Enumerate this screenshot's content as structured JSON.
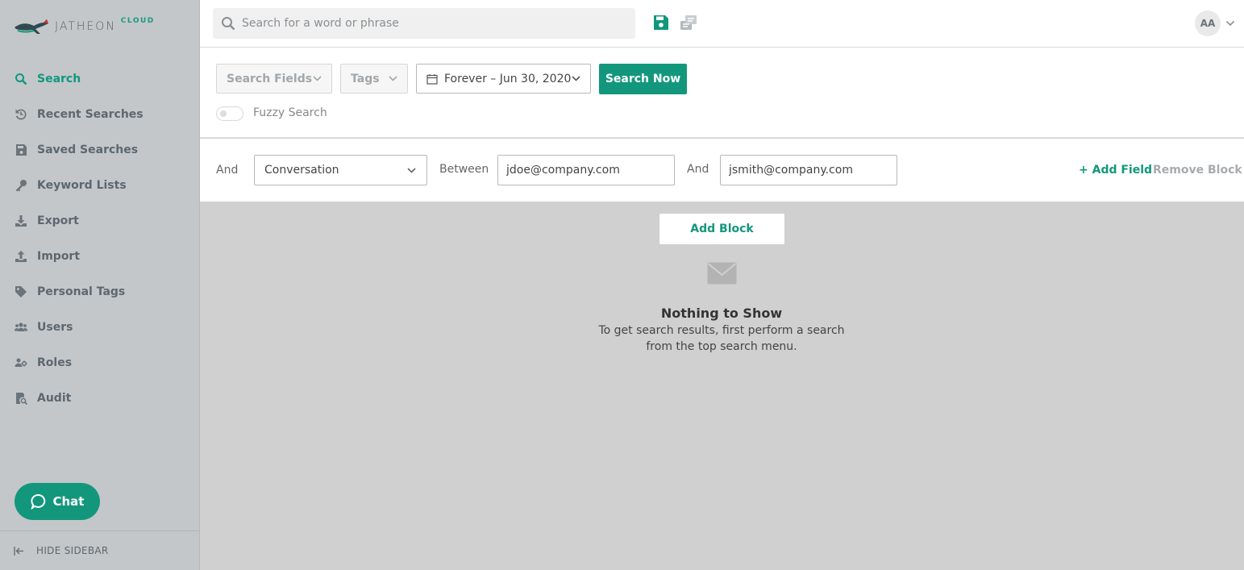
{
  "brand": {
    "name": "JATHEON",
    "suffix": "CLOUD",
    "accent_color": "#12977c"
  },
  "topbar": {
    "search_placeholder": "Search for a word or phrase",
    "avatar_initials": "AA",
    "icons": [
      "search-icon",
      "save-icon",
      "sync-icon",
      "chevron-down-icon"
    ]
  },
  "sidebar": {
    "items": [
      {
        "label": "Search",
        "icon": "search-icon",
        "active": true
      },
      {
        "label": "Recent Searches",
        "icon": "history-icon"
      },
      {
        "label": "Saved Searches",
        "icon": "save-icon"
      },
      {
        "label": "Keyword Lists",
        "icon": "key-icon"
      },
      {
        "label": "Export",
        "icon": "download-icon"
      },
      {
        "label": "Import",
        "icon": "upload-icon"
      },
      {
        "label": "Personal Tags",
        "icon": "tag-icon"
      },
      {
        "label": "Users",
        "icon": "users-icon"
      },
      {
        "label": "Roles",
        "icon": "roles-icon"
      },
      {
        "label": "Audit",
        "icon": "audit-icon"
      }
    ],
    "chat_label": "Chat",
    "hide_label": "HIDE SIDEBAR"
  },
  "filters": {
    "search_fields_label": "Search Fields",
    "tags_label": "Tags",
    "date_range": "Forever – Jun 30, 2020",
    "search_now_label": "Search Now",
    "fuzzy_label": "Fuzzy Search",
    "fuzzy_enabled": false
  },
  "block": {
    "and_label": "And",
    "field_value": "Conversation",
    "between_label": "Between",
    "first_value": "jdoe@company.com",
    "and2_label": "And",
    "second_value": "jsmith@company.com",
    "add_field_label": "+ Add Field",
    "remove_block_label": "Remove Block"
  },
  "content": {
    "add_block_label": "Add Block",
    "empty_title": "Nothing to Show",
    "empty_line1": "To get search results, first perform a search",
    "empty_line2": "from the top search menu."
  }
}
